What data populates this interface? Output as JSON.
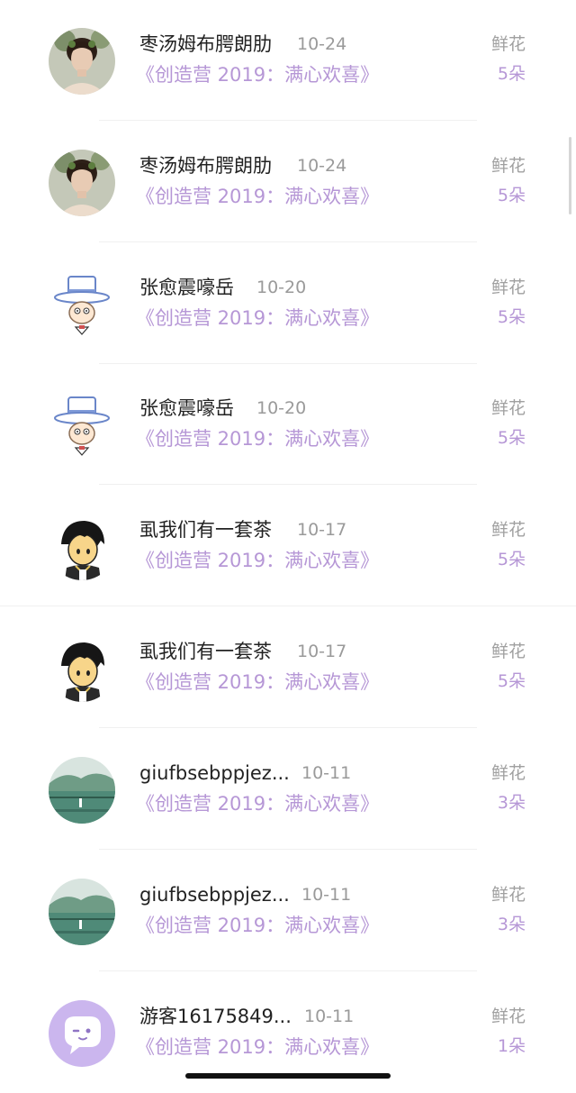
{
  "items": [
    {
      "name": "枣汤姆布腭朗肋",
      "date": "10-24",
      "book": "《创造营 2019：满心欢喜》",
      "gift": "鲜花",
      "count": "5朵",
      "avatar": "woman-portrait"
    },
    {
      "name": "枣汤姆布腭朗肋",
      "date": "10-24",
      "book": "《创造营 2019：满心欢喜》",
      "gift": "鲜花",
      "count": "5朵",
      "avatar": "woman-portrait"
    },
    {
      "name": "张愈震嚎岳",
      "date": "10-20",
      "book": "《创造营 2019：满心欢喜》",
      "gift": "鲜花",
      "count": "5朵",
      "avatar": "cartoon-top-hat"
    },
    {
      "name": "张愈震嚎岳",
      "date": "10-20",
      "book": "《创造营 2019：满心欢喜》",
      "gift": "鲜花",
      "count": "5朵",
      "avatar": "cartoon-top-hat"
    },
    {
      "name": "虱我们有一套茶",
      "date": "10-17",
      "book": "《创造营 2019：满心欢喜》",
      "gift": "鲜花",
      "count": "5朵",
      "avatar": "cartoon-boy"
    },
    {
      "name": "虱我们有一套茶",
      "date": "10-17",
      "book": "《创造营 2019：满心欢喜》",
      "gift": "鲜花",
      "count": "5朵",
      "avatar": "cartoon-boy"
    },
    {
      "name": "giufbsebppjez...",
      "date": "10-11",
      "book": "《创造营 2019：满心欢喜》",
      "gift": "鲜花",
      "count": "3朵",
      "avatar": "landscape"
    },
    {
      "name": "giufbsebppjez...",
      "date": "10-11",
      "book": "《创造营 2019：满心欢喜》",
      "gift": "鲜花",
      "count": "3朵",
      "avatar": "landscape"
    },
    {
      "name": "游客16175849...",
      "date": "10-11",
      "book": "《创造营 2019：满心欢喜》",
      "gift": "鲜花",
      "count": "1朵",
      "avatar": "guest-chat-bubble"
    }
  ],
  "colors": {
    "accent": "#b697d6",
    "name": "#222222",
    "muted": "#9a9a9a",
    "guest_avatar_bg": "#cbb6ee"
  }
}
